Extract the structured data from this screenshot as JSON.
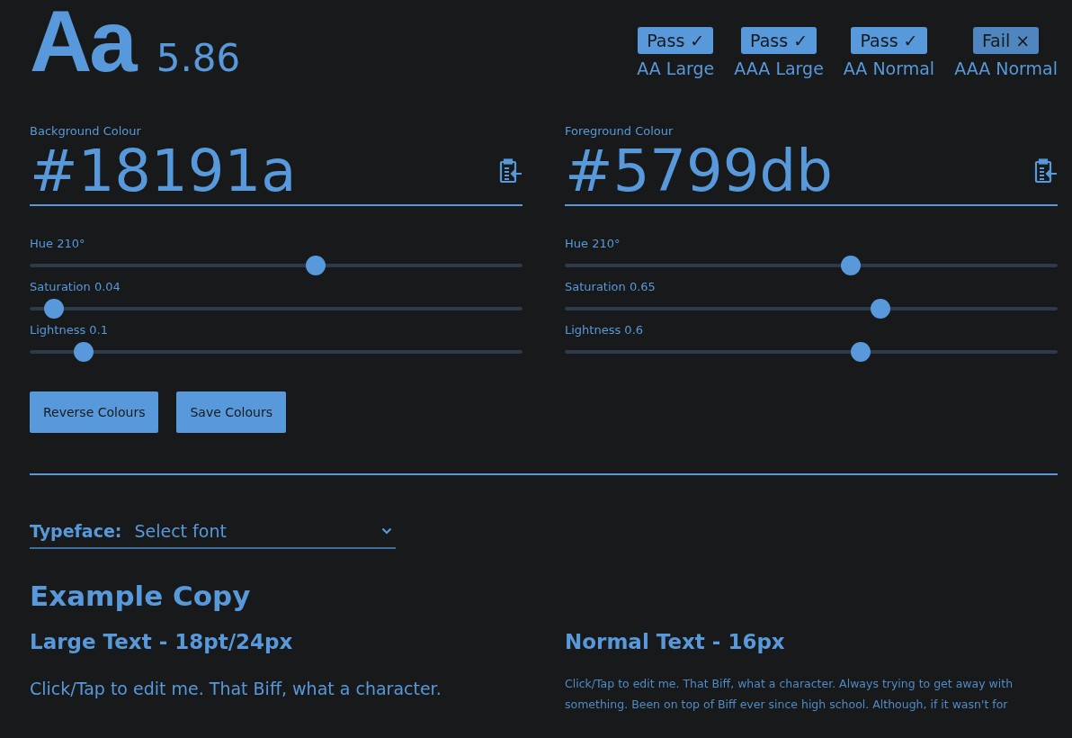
{
  "sample": {
    "glyphs": "Aa",
    "ratio": "5.86"
  },
  "checks": [
    {
      "result": "Pass",
      "symbol": "✓",
      "passed": true,
      "label": "AA Large"
    },
    {
      "result": "Pass",
      "symbol": "✓",
      "passed": true,
      "label": "AAA Large"
    },
    {
      "result": "Pass",
      "symbol": "✓",
      "passed": true,
      "label": "AA Normal"
    },
    {
      "result": "Fail",
      "symbol": "×",
      "passed": false,
      "label": "AAA Normal"
    }
  ],
  "colours": [
    {
      "label": "Background Colour",
      "value": "#18191a",
      "sliders": [
        {
          "label": "Hue 210°",
          "level": 0.58
        },
        {
          "label": "Saturation 0.04",
          "level": 0.05
        },
        {
          "label": "Lightness 0.1",
          "level": 0.11
        }
      ]
    },
    {
      "label": "Foreground Colour",
      "value": "#5799db",
      "sliders": [
        {
          "label": "Hue 210°",
          "level": 0.58
        },
        {
          "label": "Saturation 0.65",
          "level": 0.64
        },
        {
          "label": "Lightness 0.6",
          "level": 0.6
        }
      ]
    }
  ],
  "buttons": [
    "Reverse Colours",
    "Save Colours"
  ],
  "typeface": {
    "label": "Typeface:",
    "placeholder": "Select font"
  },
  "example": {
    "title": "Example Copy",
    "columns": [
      {
        "heading": "Large Text - 18pt/24px",
        "text": "Click/Tap to edit me. That Biff, what a character."
      },
      {
        "heading": "Normal Text - 16px",
        "text": "Click/Tap to edit me. That Biff, what a character. Always trying to get away with something. Been on top of Biff ever since high school. Although, if it wasn't for"
      }
    ]
  }
}
